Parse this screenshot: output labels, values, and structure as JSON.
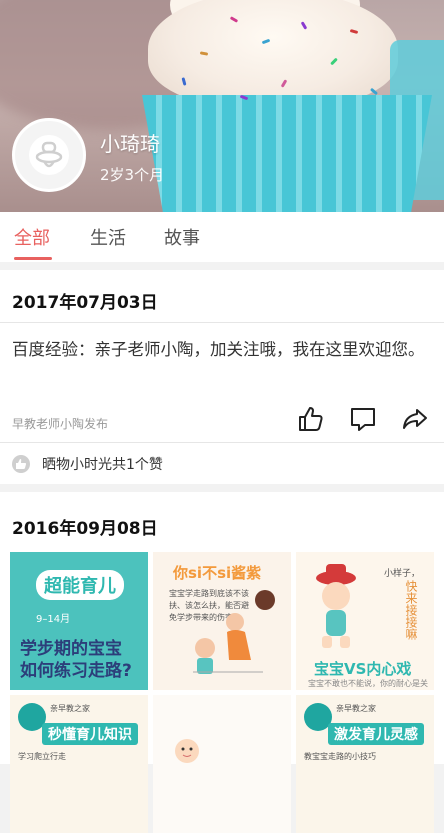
{
  "profile": {
    "name": "小琦琦",
    "age": "2岁3个月"
  },
  "tabs": [
    {
      "label": "全部",
      "active": true
    },
    {
      "label": "生活",
      "active": false
    },
    {
      "label": "故事",
      "active": false
    }
  ],
  "posts": [
    {
      "date": "2017年07月03日",
      "text": "百度经验：亲子老师小陶，加关注哦，我在这里欢迎您。",
      "publisher": "早教老师小陶发布",
      "likes_text": "晒物小时光共1个赞",
      "actions": [
        "like-icon",
        "comment-icon",
        "share-icon"
      ]
    },
    {
      "date": "2016年09月08日",
      "images": [
        {
          "badge": "超能育儿",
          "age_range": "9–14月",
          "line1": "学步期的宝宝",
          "line2": "如何练习走路?"
        },
        {
          "heading": "你si不si酱紫",
          "body": "宝宝学走路到底该不该扶、该怎么扶，能否避免学步带来的伤害？"
        },
        {
          "small": "小样子，",
          "vertical": "快来接接嘛",
          "title": "宝宝VS内心戏",
          "sub": "宝宝不敢也不能说，你的耐心是关键"
        },
        {
          "tag": "亲早教之家",
          "title": "秒懂育儿知识",
          "note": "学习爬立行走"
        },
        {},
        {
          "tag": "亲早教之家",
          "title": "激发育儿灵感",
          "note": "教宝宝走路的小技巧"
        }
      ]
    }
  ],
  "colors": {
    "accent": "#e8615f",
    "teal": "#2fb8b0"
  }
}
